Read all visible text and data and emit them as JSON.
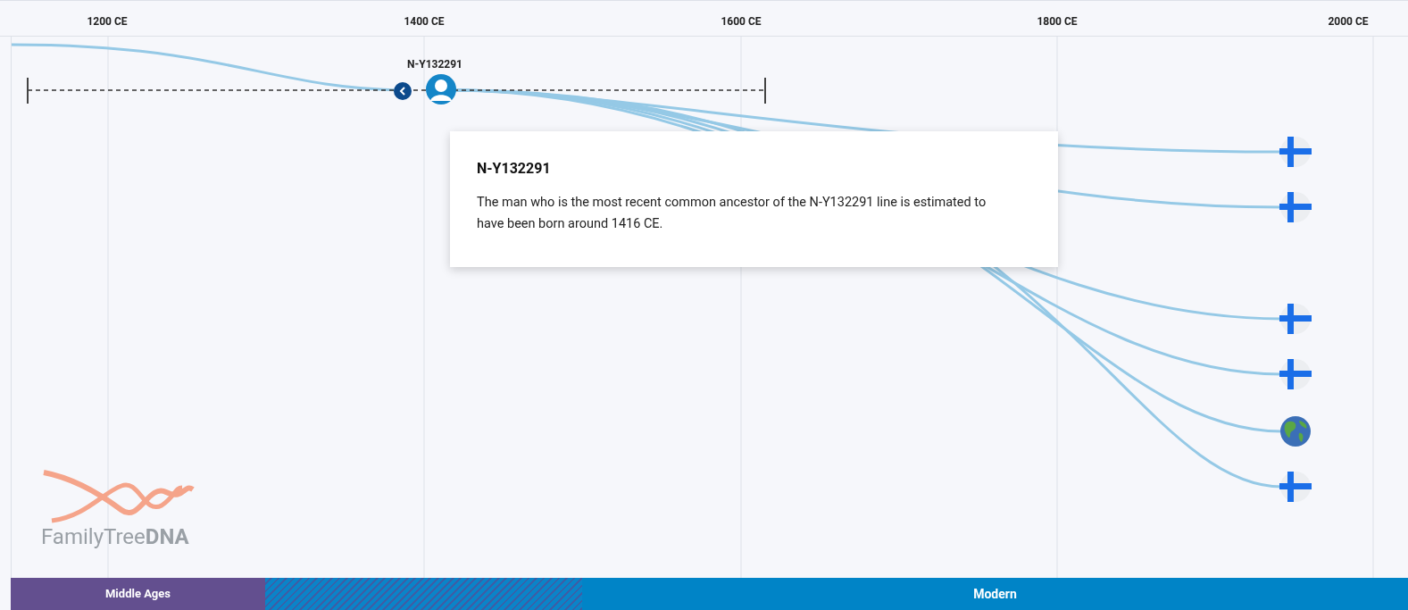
{
  "axis": {
    "ticks": [
      "1200 CE",
      "1400 CE",
      "1600 CE",
      "1800 CE",
      "2000 CE"
    ]
  },
  "ancestor": {
    "label": "N-Y132291"
  },
  "tooltip": {
    "title": "N-Y132291",
    "body": "The man who is the most recent common ancestor of the N-Y132291 line is estimated to have been born around 1416 CE."
  },
  "descendants": [
    {
      "kind": "flag"
    },
    {
      "kind": "flag"
    },
    {
      "kind": "flag"
    },
    {
      "kind": "flag"
    },
    {
      "kind": "globe"
    },
    {
      "kind": "flag"
    }
  ],
  "logo": {
    "text": "FamilyTree**DNA**"
  },
  "eras": [
    {
      "kind": "solid",
      "label": "Middle Ages"
    },
    {
      "kind": "hatched"
    },
    {
      "kind": "modern",
      "label": "Modern"
    }
  ]
}
